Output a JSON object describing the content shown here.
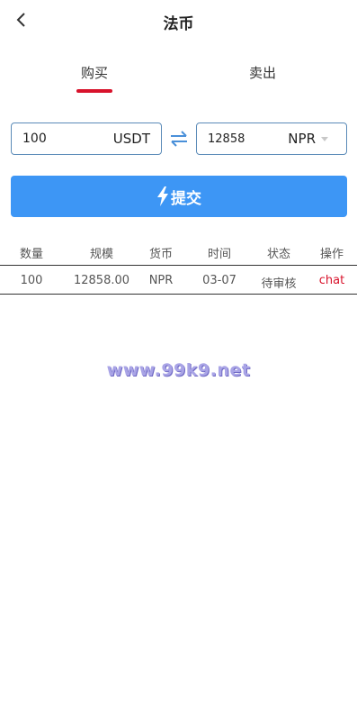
{
  "header": {
    "title": "法币"
  },
  "tabs": [
    {
      "label": "购买",
      "active": true
    },
    {
      "label": "卖出",
      "active": false
    }
  ],
  "form": {
    "amount_value": "100",
    "amount_unit": "USDT",
    "fiat_value": "12858",
    "fiat_unit": "NPR",
    "submit_label": "提交"
  },
  "table": {
    "headers": [
      "数量",
      "规模",
      "货币",
      "时间",
      "状态",
      "操作"
    ],
    "rows": [
      {
        "qty": "100",
        "scale": "12858.00",
        "currency": "NPR",
        "time": "03-07",
        "status": "待审核",
        "action": "chat"
      }
    ]
  },
  "watermark": "www.99k9.net",
  "colors": {
    "accent": "#3d96f5",
    "active_tab_underline": "#d8122b",
    "chat_link": "#d8122b",
    "input_border": "#5b8bb8"
  },
  "icons": {
    "back": "chevron-left-icon",
    "swap": "swap-arrows-icon",
    "submit": "lightning-icon",
    "dropdown": "caret-down-icon"
  }
}
